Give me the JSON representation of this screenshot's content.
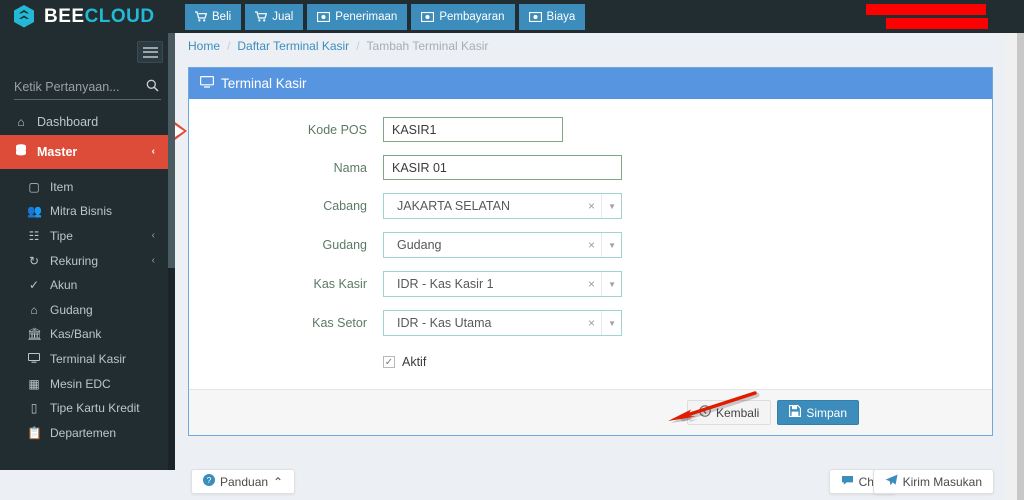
{
  "brand": {
    "bee": "BEE",
    "cloud": "CLOUD",
    "logo_icon": "hexagon-bee-logo"
  },
  "colors": {
    "navbar_bg": "#222d32",
    "nav_button": "#3c8dbc",
    "sidebar_bg": "#222d32",
    "sidebar_active": "#dd4b39",
    "panel_header": "#5895e0",
    "accent_link": "#3c8dbc",
    "redaction": "#ff0000",
    "annotation_arrow": "#e01b00",
    "content_bg": "#ecf0f5"
  },
  "navbar": {
    "buttons": [
      {
        "label": "Beli",
        "icon": "cart-icon"
      },
      {
        "label": "Jual",
        "icon": "cart-icon"
      },
      {
        "label": "Penerimaan",
        "icon": "money-icon"
      },
      {
        "label": "Pembayaran",
        "icon": "money-icon"
      },
      {
        "label": "Biaya",
        "icon": "money-icon"
      }
    ]
  },
  "sidebar": {
    "toggle_icon": "hamburger-icon",
    "search": {
      "placeholder": "Ketik Pertanyaan...",
      "value": "",
      "icon": "search-icon"
    },
    "items": [
      {
        "label": "Dashboard",
        "icon": "home-icon",
        "active": false,
        "caret": ""
      },
      {
        "label": "Master",
        "icon": "database-icon",
        "active": true,
        "caret": "‹"
      }
    ],
    "submenu": [
      {
        "label": "Item",
        "icon": "cube-icon",
        "caret": ""
      },
      {
        "label": "Mitra Bisnis",
        "icon": "users-icon",
        "caret": ""
      },
      {
        "label": "Tipe",
        "icon": "sitemap-icon",
        "caret": "‹"
      },
      {
        "label": "Rekuring",
        "icon": "refresh-icon",
        "caret": "‹"
      },
      {
        "label": "Akun",
        "icon": "check-icon",
        "caret": ""
      },
      {
        "label": "Gudang",
        "icon": "home-icon",
        "caret": ""
      },
      {
        "label": "Kas/Bank",
        "icon": "bank-icon",
        "caret": ""
      },
      {
        "label": "Terminal Kasir",
        "icon": "desktop-icon",
        "caret": ""
      },
      {
        "label": "Mesin EDC",
        "icon": "calculator-icon",
        "caret": ""
      },
      {
        "label": "Tipe Kartu Kredit",
        "icon": "credit-card-icon",
        "caret": ""
      },
      {
        "label": "Departemen",
        "icon": "clipboard-icon",
        "caret": ""
      }
    ]
  },
  "breadcrumb": {
    "home": "Home",
    "sep": "/",
    "parent": "Daftar Terminal Kasir",
    "current": "Tambah Terminal Kasir"
  },
  "panel": {
    "title": "Terminal Kasir",
    "title_icon": "desktop-icon",
    "fields": [
      {
        "label": "Kode POS",
        "type": "text",
        "value": "KASIR1",
        "width": "w1"
      },
      {
        "label": "Nama",
        "type": "text",
        "value": "KASIR 01",
        "width": "w2"
      },
      {
        "label": "Cabang",
        "type": "select",
        "value": "JAKARTA SELATAN",
        "width": "w3"
      },
      {
        "label": "Gudang",
        "type": "select",
        "value": "Gudang",
        "width": "w3"
      },
      {
        "label": "Kas Kasir",
        "type": "select",
        "value": "IDR - Kas Kasir 1",
        "width": "w3"
      },
      {
        "label": "Kas Setor",
        "type": "select",
        "value": "IDR - Kas Utama",
        "width": "w3"
      }
    ],
    "checkbox": {
      "label": "Aktif",
      "checked": true,
      "mark": "✓"
    },
    "select_clear": "×",
    "select_caret": "▼",
    "buttons": {
      "back": {
        "label": "Kembali",
        "icon": "back-circle-icon"
      },
      "save": {
        "label": "Simpan",
        "icon": "floppy-disk-icon"
      }
    }
  },
  "footer": {
    "panduan": {
      "label": "Panduan",
      "icon": "question-circle-icon",
      "caret": "⌃"
    },
    "chat": {
      "label": "Chat",
      "icon": "comment-icon"
    },
    "kirim": {
      "label": "Kirim Masukan",
      "icon": "paper-plane-icon"
    }
  }
}
